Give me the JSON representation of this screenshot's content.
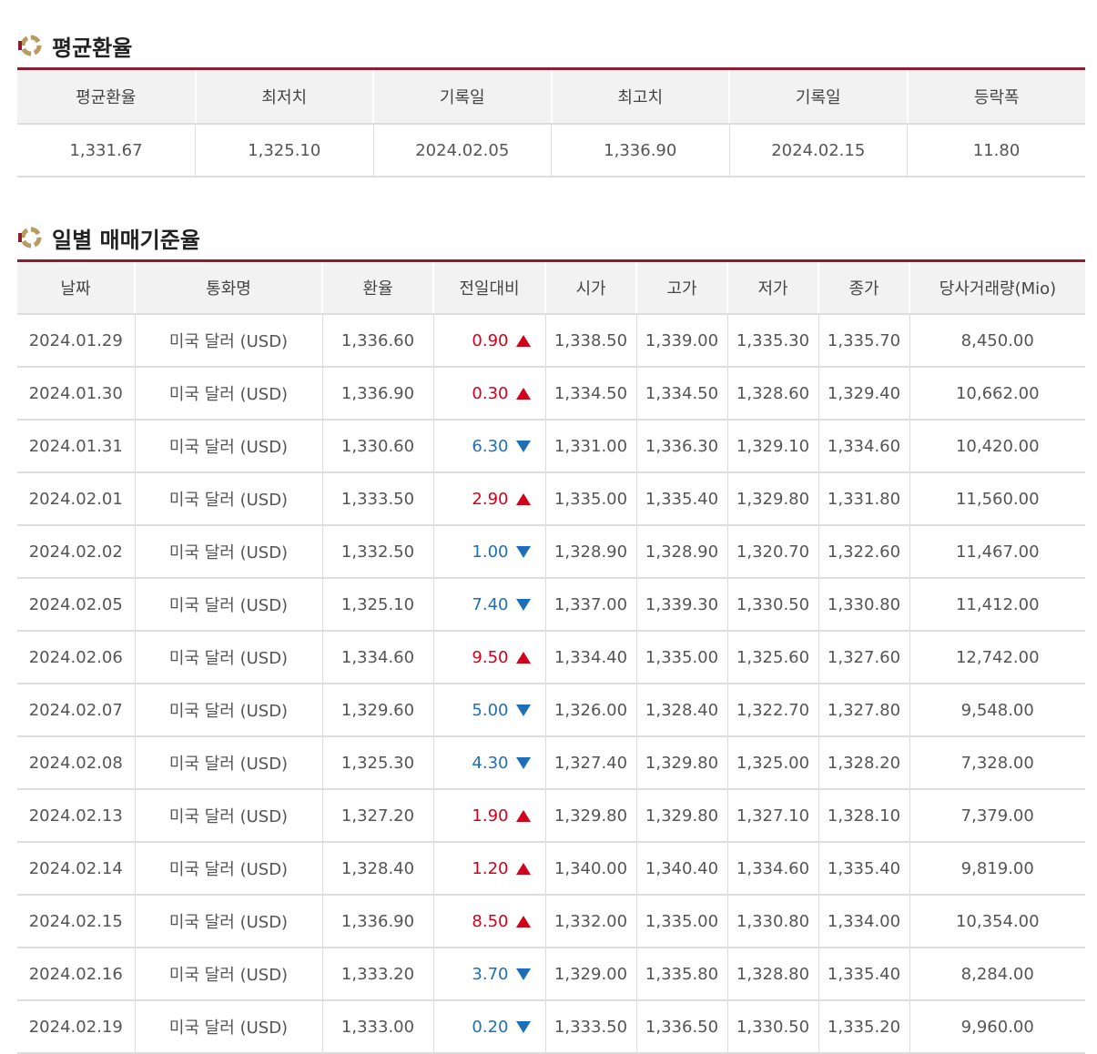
{
  "summary": {
    "title": "평균환율",
    "headers": [
      "평균환율",
      "최저치",
      "기록일",
      "최고치",
      "기록일",
      "등락폭"
    ],
    "values": [
      "1,331.67",
      "1,325.10",
      "2024.02.05",
      "1,336.90",
      "2024.02.15",
      "11.80"
    ]
  },
  "daily": {
    "title": "일별 매매기준율",
    "headers": [
      "날짜",
      "통화명",
      "환율",
      "전일대비",
      "시가",
      "고가",
      "저가",
      "종가",
      "당사거래량(Mio)"
    ],
    "rows": [
      {
        "date": "2024.01.29",
        "currency": "미국 달러 (USD)",
        "rate": "1,336.60",
        "change": "0.90",
        "dir": "up",
        "open": "1,338.50",
        "high": "1,339.00",
        "low": "1,335.30",
        "close": "1,335.70",
        "volume": "8,450.00"
      },
      {
        "date": "2024.01.30",
        "currency": "미국 달러 (USD)",
        "rate": "1,336.90",
        "change": "0.30",
        "dir": "up",
        "open": "1,334.50",
        "high": "1,334.50",
        "low": "1,328.60",
        "close": "1,329.40",
        "volume": "10,662.00"
      },
      {
        "date": "2024.01.31",
        "currency": "미국 달러 (USD)",
        "rate": "1,330.60",
        "change": "6.30",
        "dir": "down",
        "open": "1,331.00",
        "high": "1,336.30",
        "low": "1,329.10",
        "close": "1,334.60",
        "volume": "10,420.00"
      },
      {
        "date": "2024.02.01",
        "currency": "미국 달러 (USD)",
        "rate": "1,333.50",
        "change": "2.90",
        "dir": "up",
        "open": "1,335.00",
        "high": "1,335.40",
        "low": "1,329.80",
        "close": "1,331.80",
        "volume": "11,560.00"
      },
      {
        "date": "2024.02.02",
        "currency": "미국 달러 (USD)",
        "rate": "1,332.50",
        "change": "1.00",
        "dir": "down",
        "open": "1,328.90",
        "high": "1,328.90",
        "low": "1,320.70",
        "close": "1,322.60",
        "volume": "11,467.00"
      },
      {
        "date": "2024.02.05",
        "currency": "미국 달러 (USD)",
        "rate": "1,325.10",
        "change": "7.40",
        "dir": "down",
        "open": "1,337.00",
        "high": "1,339.30",
        "low": "1,330.50",
        "close": "1,330.80",
        "volume": "11,412.00"
      },
      {
        "date": "2024.02.06",
        "currency": "미국 달러 (USD)",
        "rate": "1,334.60",
        "change": "9.50",
        "dir": "up",
        "open": "1,334.40",
        "high": "1,335.00",
        "low": "1,325.60",
        "close": "1,327.60",
        "volume": "12,742.00"
      },
      {
        "date": "2024.02.07",
        "currency": "미국 달러 (USD)",
        "rate": "1,329.60",
        "change": "5.00",
        "dir": "down",
        "open": "1,326.00",
        "high": "1,328.40",
        "low": "1,322.70",
        "close": "1,327.80",
        "volume": "9,548.00"
      },
      {
        "date": "2024.02.08",
        "currency": "미국 달러 (USD)",
        "rate": "1,325.30",
        "change": "4.30",
        "dir": "down",
        "open": "1,327.40",
        "high": "1,329.80",
        "low": "1,325.00",
        "close": "1,328.20",
        "volume": "7,328.00"
      },
      {
        "date": "2024.02.13",
        "currency": "미국 달러 (USD)",
        "rate": "1,327.20",
        "change": "1.90",
        "dir": "up",
        "open": "1,329.80",
        "high": "1,329.80",
        "low": "1,327.10",
        "close": "1,328.10",
        "volume": "7,379.00"
      },
      {
        "date": "2024.02.14",
        "currency": "미국 달러 (USD)",
        "rate": "1,328.40",
        "change": "1.20",
        "dir": "up",
        "open": "1,340.00",
        "high": "1,340.40",
        "low": "1,334.60",
        "close": "1,335.40",
        "volume": "9,819.00"
      },
      {
        "date": "2024.02.15",
        "currency": "미국 달러 (USD)",
        "rate": "1,336.90",
        "change": "8.50",
        "dir": "up",
        "open": "1,332.00",
        "high": "1,335.00",
        "low": "1,330.80",
        "close": "1,334.00",
        "volume": "10,354.00"
      },
      {
        "date": "2024.02.16",
        "currency": "미국 달러 (USD)",
        "rate": "1,333.20",
        "change": "3.70",
        "dir": "down",
        "open": "1,329.00",
        "high": "1,335.80",
        "low": "1,328.80",
        "close": "1,335.40",
        "volume": "8,284.00"
      },
      {
        "date": "2024.02.19",
        "currency": "미국 달러 (USD)",
        "rate": "1,333.00",
        "change": "0.20",
        "dir": "down",
        "open": "1,333.50",
        "high": "1,336.50",
        "low": "1,330.50",
        "close": "1,335.20",
        "volume": "9,960.00"
      }
    ]
  },
  "colors": {
    "accent": "#8c1c2e",
    "up": "#d0021b",
    "down": "#1f6fb8",
    "header_bg": "#f2f2f2"
  },
  "icons": {
    "section": "ring-logo-icon",
    "up": "triangle-up-icon",
    "down": "triangle-down-icon"
  }
}
